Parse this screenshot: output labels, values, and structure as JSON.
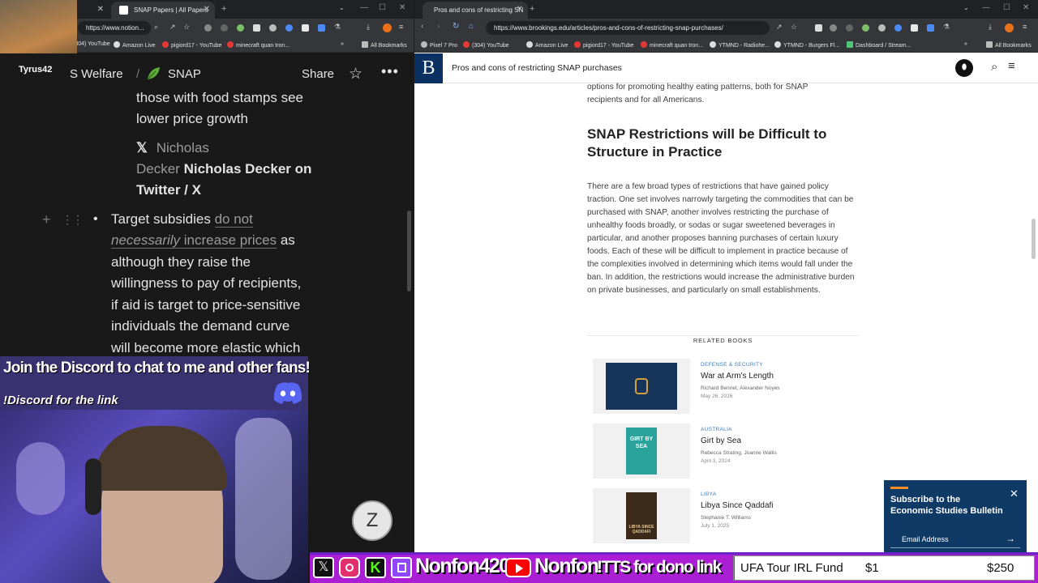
{
  "left_window": {
    "tabs": [
      {
        "label": ""
      },
      {
        "label": "SNAP Papers | All Papers"
      }
    ],
    "url": "https://www.notion...",
    "bookmarks": [
      "(304) YouTube",
      "Amazon Live",
      "pigiord17 - YouTube",
      "minecraft quan tron...",
      "All Bookmarks"
    ],
    "header": {
      "username": "Tyrus42",
      "crumb_1": "S Welfare",
      "crumb_2": "SNAP",
      "share": "Share"
    },
    "body": {
      "line1": "those with food stamps see",
      "line2": "lower price growth",
      "tw_name_1": "Nicholas",
      "tw_name_2": "Decker",
      "tw_title_1": "Nicholas Decker on",
      "tw_title_2": "Twitter / X",
      "b_1a": "Target subsidies ",
      "b_1b": "do not",
      "b_2a": "necessarily",
      "b_2b": " increase prices",
      "b_2c": " as",
      "b_3": "although they raise the",
      "b_4": "willingness to pay of recipients,",
      "b_5": "if aid is target to price-sensitive",
      "b_6": "individuals the demand curve",
      "b_7": "will become more elastic which"
    },
    "overlay": {
      "discord_line": "Join the Discord to chat to me and other fans!",
      "discord_cmd": "!Discord for the link"
    }
  },
  "right_window": {
    "tab_label": "Pros and cons of restricting SN",
    "url": "https://www.brookings.edu/articles/pros-and-cons-of-restricting-snap-purchases/",
    "bookmarks": [
      "Pixel 7 Pro",
      "(304) YouTube",
      "Amazon Live",
      "pigiord17 - YouTube",
      "minecraft quan tron...",
      "YTMND - Radiohe...",
      "YTMND - Burgers Fl...",
      "Dashboard / Stream...",
      "All Bookmarks"
    ],
    "site": {
      "logo": "B",
      "page_title": "Pros and cons of restricting SNAP purchases"
    },
    "article": {
      "intro_1": "options for promoting healthy eating patterns, both for SNAP",
      "intro_2": "recipients and for all Americans.",
      "heading": "SNAP Restrictions will be Difficult to Structure in Practice",
      "paragraph": "There are a few broad types of restrictions that have gained policy traction. One set involves narrowly targeting the commodities that can be purchased with SNAP, another involves restricting the purchase of unhealthy foods broadly, or sodas or sugar sweetened beverages in particular, and another proposes banning purchases of certain luxury foods. Each of these will be difficult to implement in practice because of the complexities involved in determining which items would fall under the ban. In addition, the restrictions would increase the administrative burden on private businesses, and particularly on small establishments."
    },
    "related_label": "RELATED BOOKS",
    "books": [
      {
        "category": "DEFENSE & SECURITY",
        "title": "War at Arm's Length",
        "authors": "Richard Bennet, Alexander Noyes",
        "date": "May 26, 2026"
      },
      {
        "category": "AUSTRALIA",
        "title": "Girt by Sea",
        "authors": "Rebecca Strating, Joanne Wallis",
        "date": "April 3, 2024",
        "cover_text": "GIRT BY SEA"
      },
      {
        "category": "LIBYA",
        "title": "Libya Since Qaddafi",
        "authors": "Stephanie T. Williams",
        "date": "July 1, 2025",
        "cover_text": "LIBYA SINCE QADDAFI"
      }
    ],
    "newsletter": {
      "title_1": "Subscribe to the",
      "title_2": "Economic Studies Bulletin",
      "email_placeholder": "Email Address"
    }
  },
  "stream_bar": {
    "handle_1": "Nonfon420",
    "handle_2": "Nonfon",
    "tts": "!TTS for dono link",
    "fund_label": "UFA Tour IRL Fund",
    "fund_current": "$1",
    "fund_goal": "$250"
  }
}
